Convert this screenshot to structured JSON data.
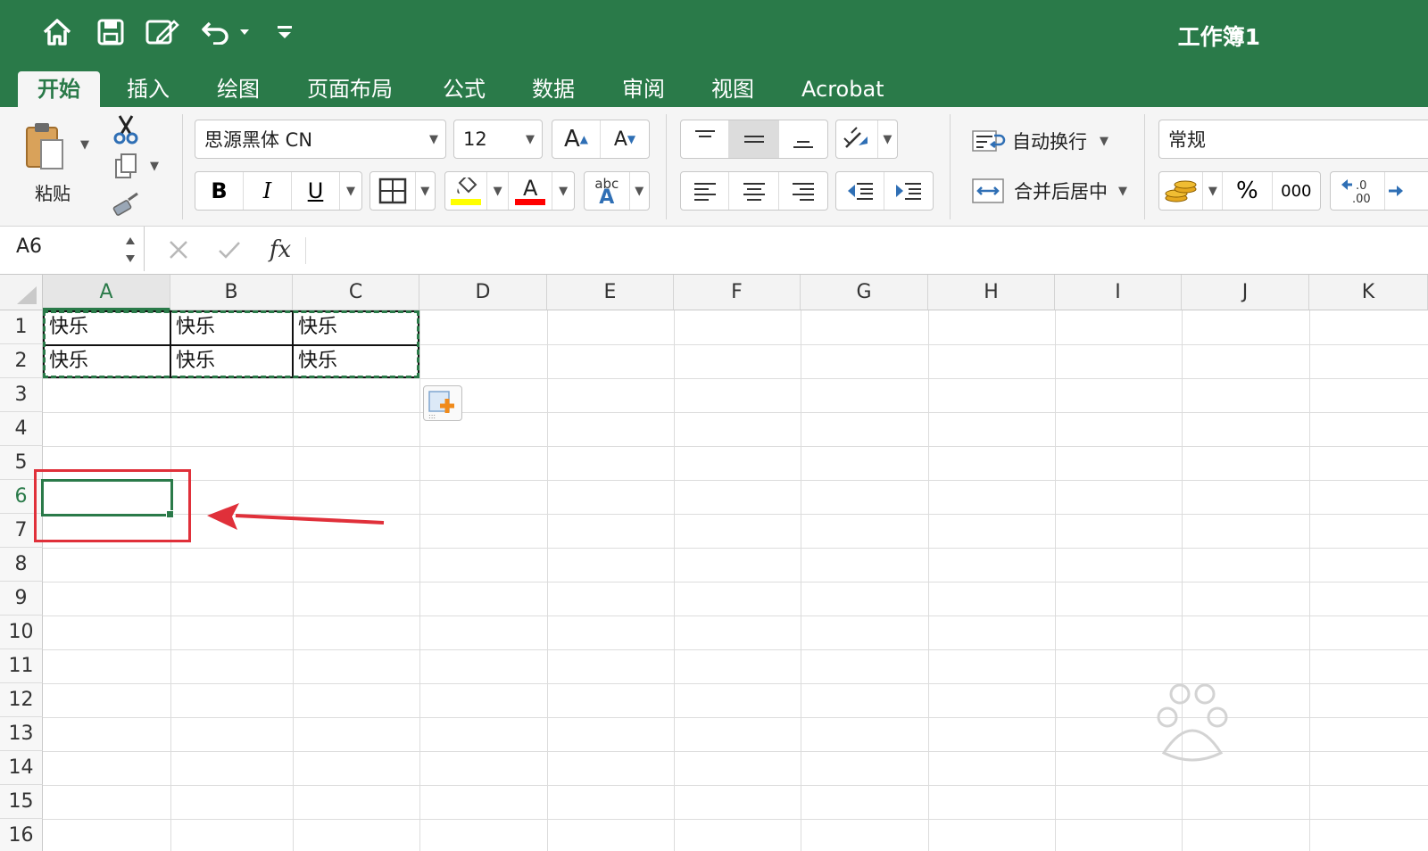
{
  "window": {
    "title": "工作簿1"
  },
  "tabs": [
    {
      "label": "开始",
      "active": true
    },
    {
      "label": "插入"
    },
    {
      "label": "绘图"
    },
    {
      "label": "页面布局"
    },
    {
      "label": "公式"
    },
    {
      "label": "数据"
    },
    {
      "label": "审阅"
    },
    {
      "label": "视图"
    },
    {
      "label": "Acrobat"
    }
  ],
  "ribbon": {
    "paste_label": "粘贴",
    "font_name": "思源黑体 CN",
    "font_size": "12",
    "bold": "B",
    "italic": "I",
    "underline": "U",
    "wrap_text": "自动换行",
    "merge_center": "合并后居中",
    "number_format": "常规",
    "percent": "%",
    "thousands": "000",
    "dec_increase": ".0\n.00",
    "font_grow": "A",
    "font_shrink": "A",
    "font_color_letter": "A",
    "abc": "abc",
    "abc_a": "A"
  },
  "formula_bar": {
    "cell_ref": "A6",
    "fx": "fx",
    "content": ""
  },
  "columns": [
    "A",
    "B",
    "C",
    "D",
    "E",
    "F",
    "G",
    "H",
    "I",
    "J",
    "K"
  ],
  "rows": [
    "1",
    "2",
    "3",
    "4",
    "5",
    "6",
    "7",
    "8",
    "9",
    "10",
    "11",
    "12",
    "13",
    "14",
    "15",
    "16"
  ],
  "cells": {
    "r1": [
      "快乐",
      "快乐",
      "快乐"
    ],
    "r2": [
      "快乐",
      "快乐",
      "快乐"
    ]
  },
  "selection": {
    "active_cell": "A6",
    "copied_range": "A1:C2"
  },
  "colors": {
    "brand": "#2a7a49",
    "annotation": "#e0303a",
    "highlight": "#ffff00",
    "font_color": "#ff0000"
  }
}
